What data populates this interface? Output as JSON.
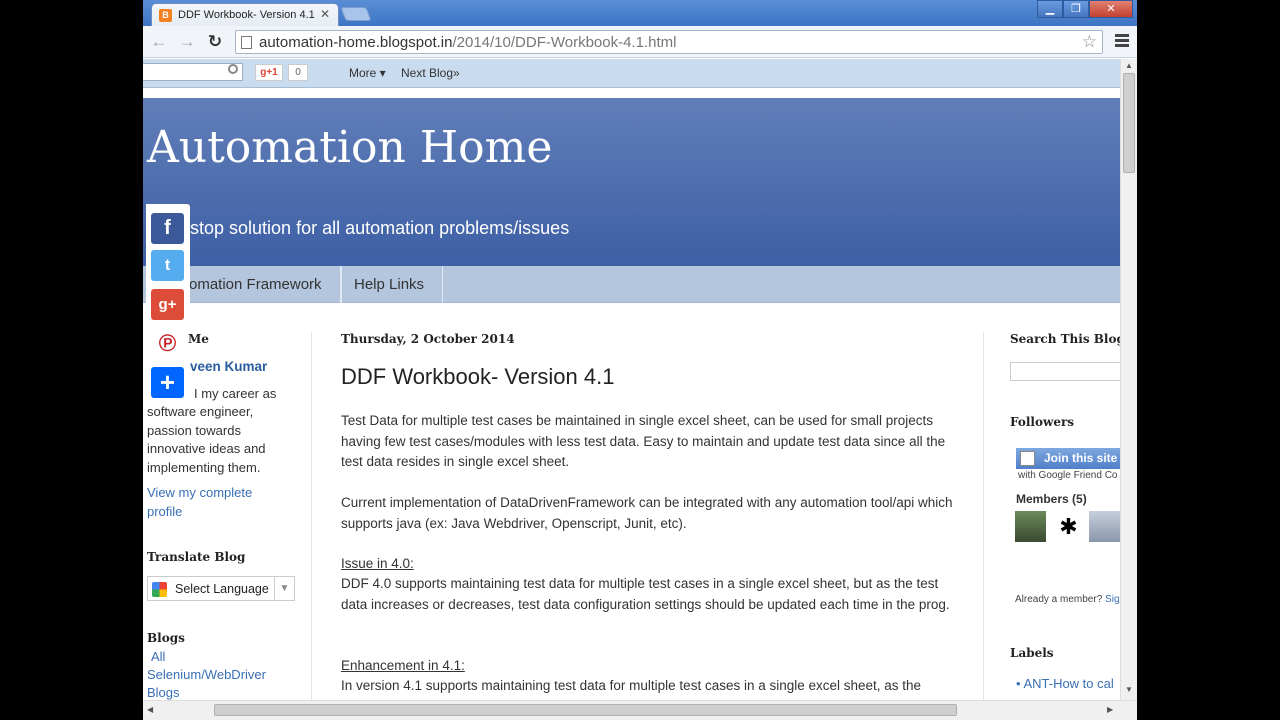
{
  "browser": {
    "tab_title": "DDF Workbook- Version 4.1",
    "tab_close": "✕",
    "url_host": "automation-home.blogspot.in",
    "url_path": "/2014/10/DDF-Workbook-4.1.html",
    "window_buttons": {
      "minimize": "▁",
      "maximize": "❐",
      "close": "✕"
    }
  },
  "navbar": {
    "gplus_label": "g+1",
    "gplus_count": "0",
    "more_label": "More ▾",
    "next_blog_label": "Next Blog»"
  },
  "blog": {
    "title": "Automation Home",
    "description": "stop solution for all automation problems/issues",
    "pages": [
      "omation Framework",
      "Help Links"
    ]
  },
  "share": {
    "icons": [
      "facebook-icon",
      "twitter-icon",
      "google-plus-icon",
      "pinterest-icon",
      "share-plus-icon"
    ],
    "colors": {
      "facebook": "#3b5998",
      "twitter": "#55acee",
      "google_plus": "#dd4b39",
      "pinterest": "#cb2027",
      "share": "#0166ff"
    }
  },
  "left_sidebar": {
    "about_heading": "Me",
    "profile_name": "veen Kumar",
    "about_line1": "I my career as",
    "about_rest": "software engineer, passion towards innovative ideas and implementing them.",
    "profile_link": "View my complete profile",
    "translate_heading": "Translate Blog",
    "translate_select": "Select Language",
    "blogs_heading": "Blogs",
    "blog_links": [
      "All",
      "Selenium/WebDriver",
      "Blogs"
    ]
  },
  "post": {
    "date": "Thursday, 2 October 2014",
    "title": "DDF Workbook- Version 4.1",
    "para1": "Test Data for multiple test cases be maintained in single excel sheet, can be used for small projects having few test cases/modules with less test data. Easy to maintain and update test data since all the test data resides in single excel sheet.",
    "para2": "Current implementation of DataDrivenFramework can be integrated with any automation tool/api which supports java (ex: Java Webdriver, Openscript, Junit, etc).",
    "issue_heading": "Issue in 4.0:",
    "issue_text": "DDF 4.0 supports maintaining test data for multiple test cases in a single excel sheet, but as the test data increases or decreases, test data configuration settings should be updated each time in the prog.",
    "enh_heading": "Enhancement in 4.1:",
    "enh_text": "In version 4.1 supports maintaining test data for multiple test cases in a single excel sheet, as the"
  },
  "right_sidebar": {
    "search_heading": "Search This Blog",
    "followers_heading": "Followers",
    "join_label": "Join this site",
    "join_sub": "with Google Friend Co",
    "members_label": "Members (5)",
    "already_member": "Already a member?",
    "sign_in": "Sig",
    "labels_heading": "Labels",
    "label_first": "ANT-How to cal"
  }
}
